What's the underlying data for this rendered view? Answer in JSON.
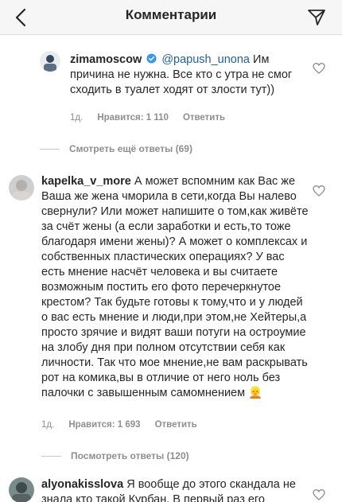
{
  "header": {
    "title": "Комментарии",
    "back_icon": "chevron-left-icon",
    "send_icon": "paper-plane-icon"
  },
  "comments": [
    {
      "username": "zimamoscow",
      "verified": true,
      "mention": "@papush_unona",
      "text": " Им причина не нужна. Все кто с утра не смог сходить в туалет ходят от злости тут))",
      "time": "1д.",
      "likes": "Нравится: 1 110",
      "reply": "Ответить"
    },
    {
      "username": "kapelka_v_more",
      "text": " А может вспомним как Вас же Ваша же жена чморила в сети,когда Вы налево свернули? Или может напишите о том,как живёте за счёт жены (а если заработки и есть,то тоже благодаря имени жены)? А может о комплексах и собственных пластических операциях? У вас есть мнение насчёт человека и вы считаете возможным постить его фото перечеркнутое крестом? Так будьте готовы к тому,что и у людей о вас есть мнение и люди,при этом,не Хейтеры,а просто зрячие и видят ваши потуги на остроумие на злобу дня при полном отсутствии себя как личности. Так что мое мнение,не вам раскрывать рот на комика,вы в отличие от него ноль без палочки с завышенным самомнением",
      "emoji": "👱",
      "time": "1д.",
      "likes": "Нравится: 1 693",
      "reply": "Ответить"
    },
    {
      "username": "alyonakisslova",
      "text": " Я вообще до этого скандала не знала кто такой Курбан. В первый раз его"
    }
  ],
  "view_replies_1": "Смотреть ещё ответы (69)",
  "view_replies_2": "Посмотреть ответы (120)",
  "colors": {
    "header_bg": "#f6f6f6",
    "text": "#262626",
    "muted": "#8e8e8e",
    "mention": "#1d5f9e",
    "verified": "#3897f0"
  }
}
